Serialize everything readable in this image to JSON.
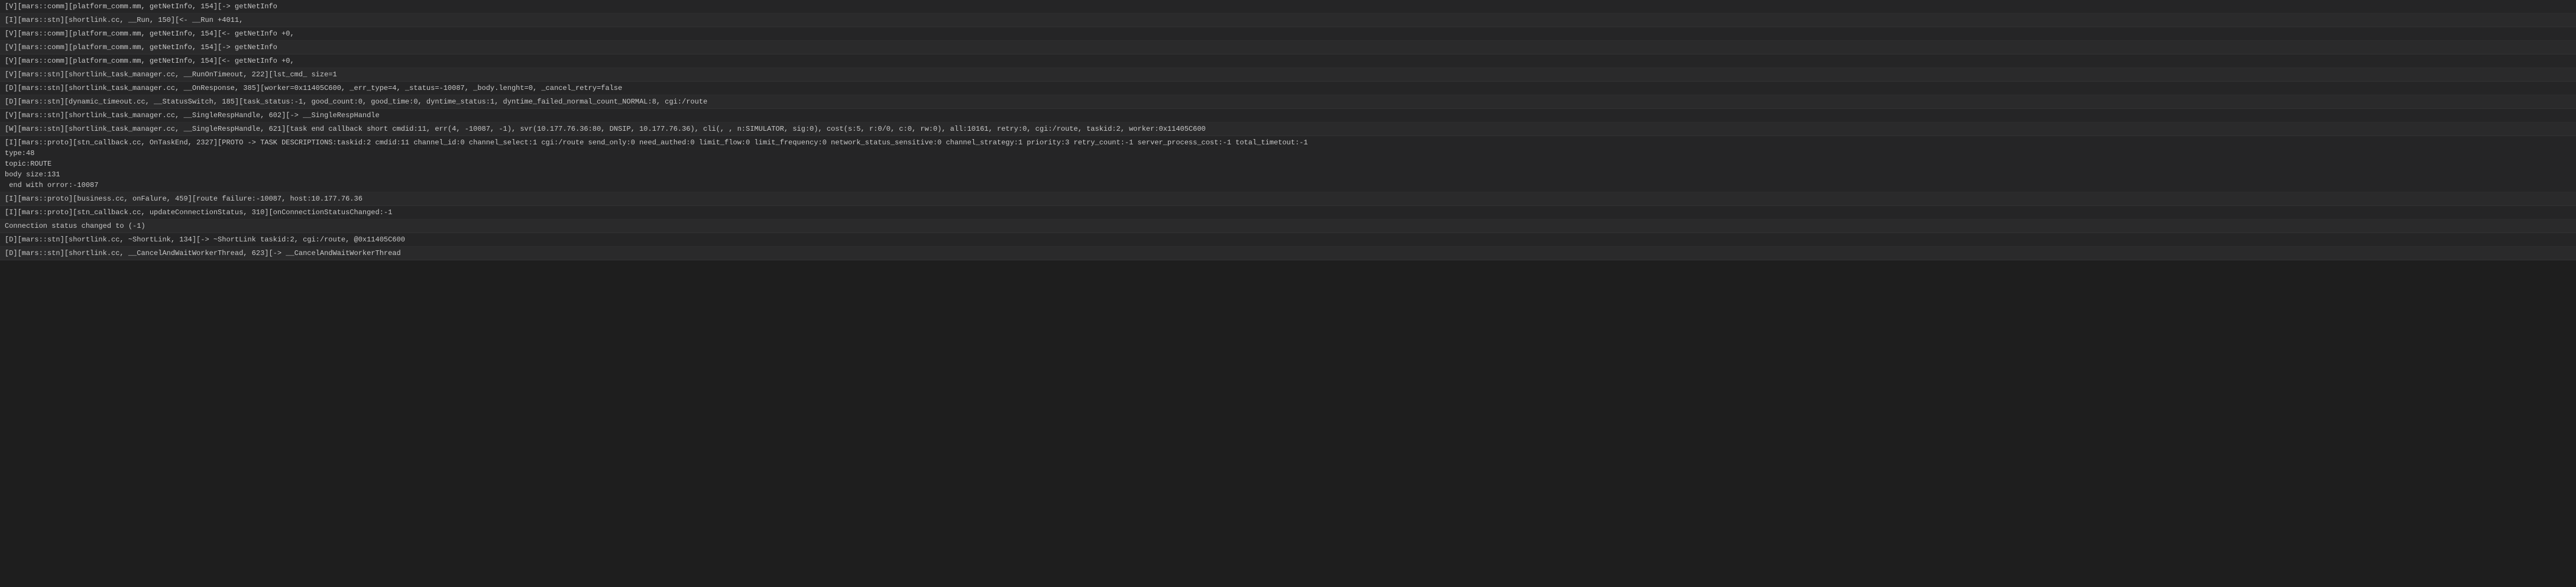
{
  "logs": [
    "[V][mars::comm][platform_comm.mm, getNetInfo, 154][-> getNetInfo",
    "[I][mars::stn][shortlink.cc, __Run, 150][<- __Run +4011,",
    "[V][mars::comm][platform_comm.mm, getNetInfo, 154][<- getNetInfo +0,",
    "[V][mars::comm][platform_comm.mm, getNetInfo, 154][-> getNetInfo",
    "[V][mars::comm][platform_comm.mm, getNetInfo, 154][<- getNetInfo +0,",
    "[V][mars::stn][shortlink_task_manager.cc, __RunOnTimeout, 222][lst_cmd_ size=1",
    "[D][mars::stn][shortlink_task_manager.cc, __OnResponse, 385][worker=0x11405C600, _err_type=4, _status=-10087, _body.lenght=0, _cancel_retry=false",
    "[D][mars::stn][dynamic_timeout.cc, __StatusSwitch, 185][task_status:-1, good_count:0, good_time:0, dyntime_status:1, dyntime_failed_normal_count_NORMAL:8, cgi:/route",
    "[V][mars::stn][shortlink_task_manager.cc, __SingleRespHandle, 602][-> __SingleRespHandle",
    "[W][mars::stn][shortlink_task_manager.cc, __SingleRespHandle, 621][task end callback short cmdid:11, err(4, -10087, -1), svr(10.177.76.36:80, DNSIP, 10.177.76.36), cli(, , n:SIMULATOR, sig:0), cost(s:5, r:0/0, c:0, rw:0), all:10161, retry:0, cgi:/route, taskid:2, worker:0x11405C600",
    "[I][mars::proto][stn_callback.cc, OnTaskEnd, 2327][PROTO -> TASK DESCRIPTIONS:taskid:2 cmdid:11 channel_id:0 channel_select:1 cgi:/route send_only:0 need_authed:0 limit_flow:0 limit_frequency:0 network_status_sensitive:0 channel_strategy:1 priority:3 retry_count:-1 server_process_cost:-1 total_timetout:-1\ntype:48\ntopic:ROUTE\nbody size:131\n end with orror:-10087",
    "[I][mars::proto][business.cc, onFalure, 459][route failure:-10087, host:10.177.76.36",
    "[I][mars::proto][stn_callback.cc, updateConnectionStatus, 310][onConnectionStatusChanged:-1",
    "Connection status changed to (-1)",
    "[D][mars::stn][shortlink.cc, ~ShortLink, 134][-> ~ShortLink taskid:2, cgi:/route, @0x11405C600",
    "[D][mars::stn][shortlink.cc, __CancelAndWaitWorkerThread, 623][-> __CancelAndWaitWorkerThread"
  ]
}
